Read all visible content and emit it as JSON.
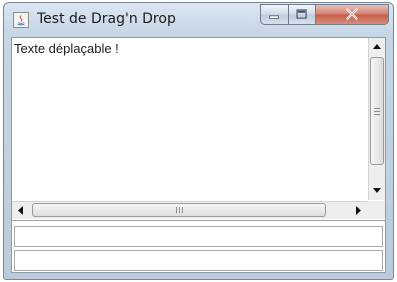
{
  "window": {
    "title": "Test de Drag'n Drop",
    "controls": [
      "minimize-icon",
      "maximize-icon",
      "close-icon"
    ]
  },
  "text_area": {
    "value": "Texte déplaçable !"
  },
  "fields": [
    {
      "value": ""
    },
    {
      "value": ""
    }
  ]
}
